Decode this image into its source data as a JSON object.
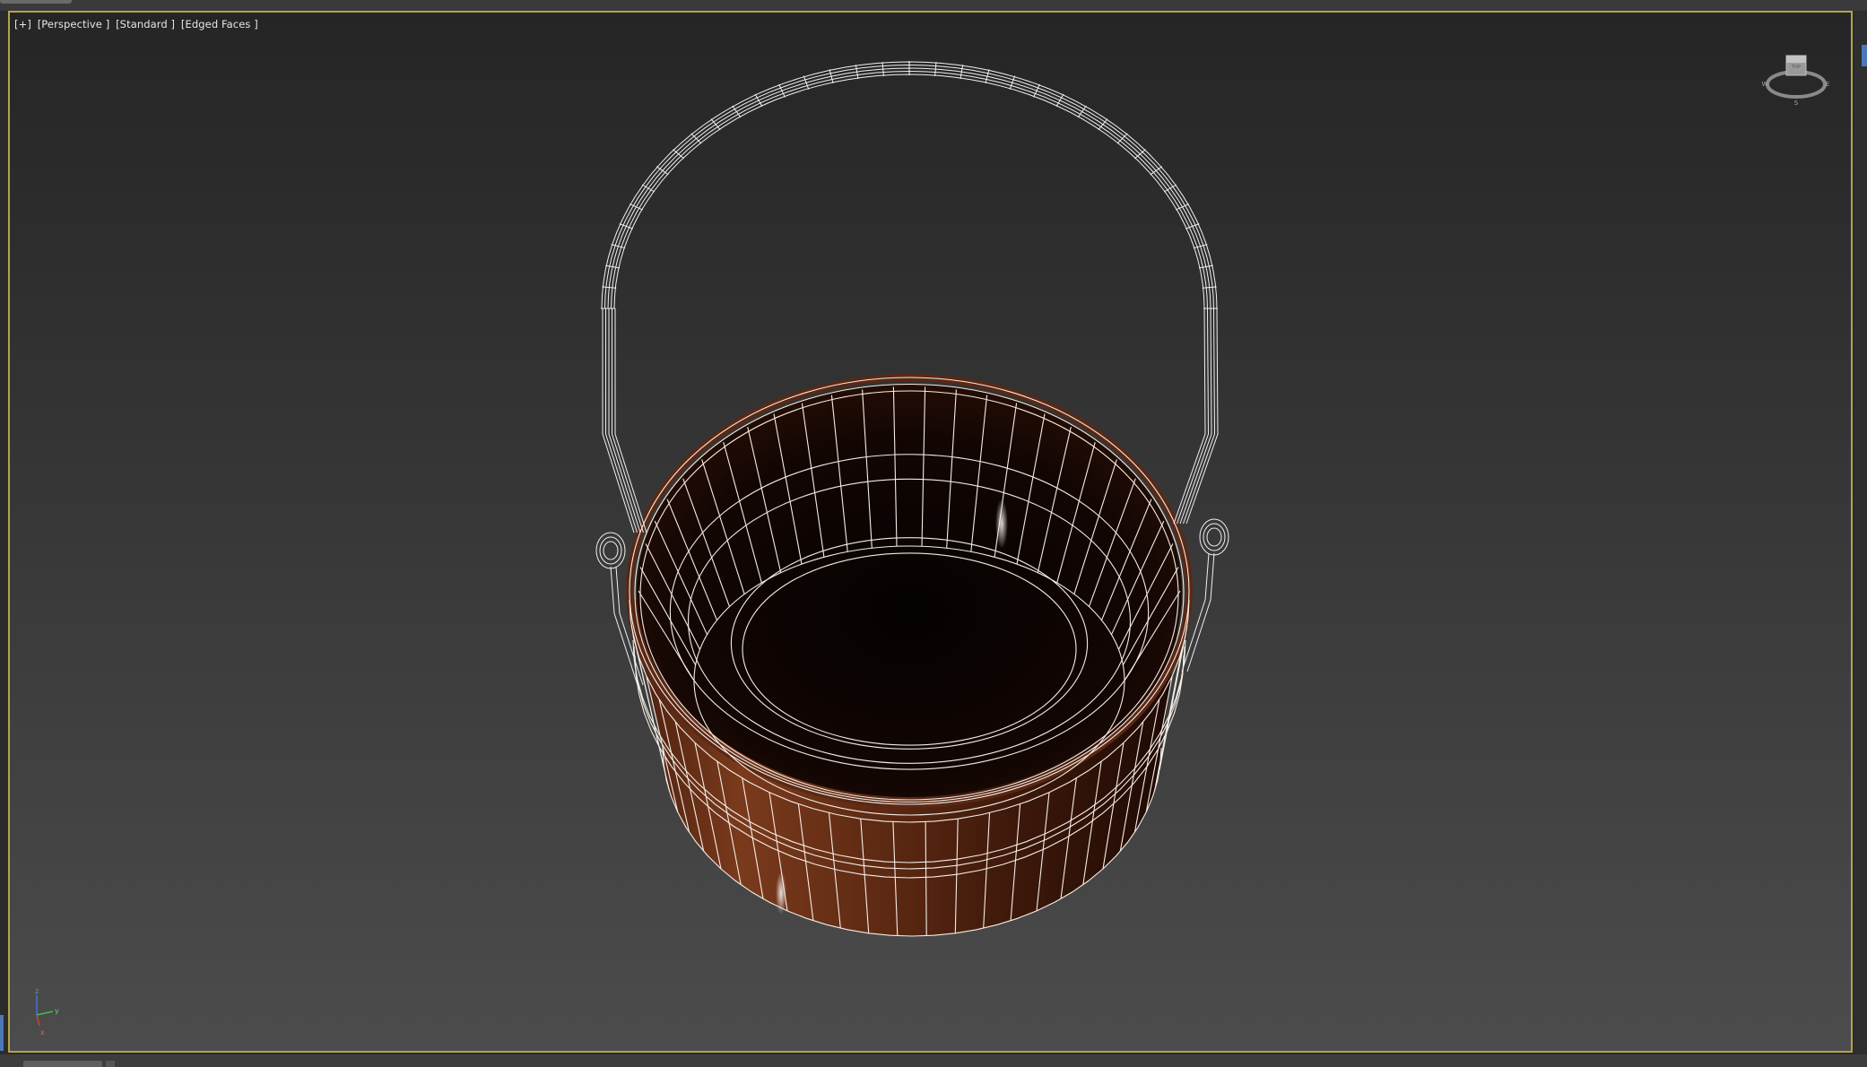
{
  "viewport": {
    "label_parts": [
      "[+]",
      "[Perspective ]",
      "[Standard ]",
      "[Edged Faces ]"
    ]
  },
  "navigation": {
    "viewcube_top": "TOP",
    "compass": {
      "left": "W",
      "right": "E",
      "bottom": "S"
    }
  },
  "axis_tripod": {
    "z": "z",
    "x": "x",
    "y": "y"
  },
  "colors": {
    "viewport_border": "#b5a34a",
    "wire": "#f4ede6",
    "copper": "#6a3118"
  }
}
